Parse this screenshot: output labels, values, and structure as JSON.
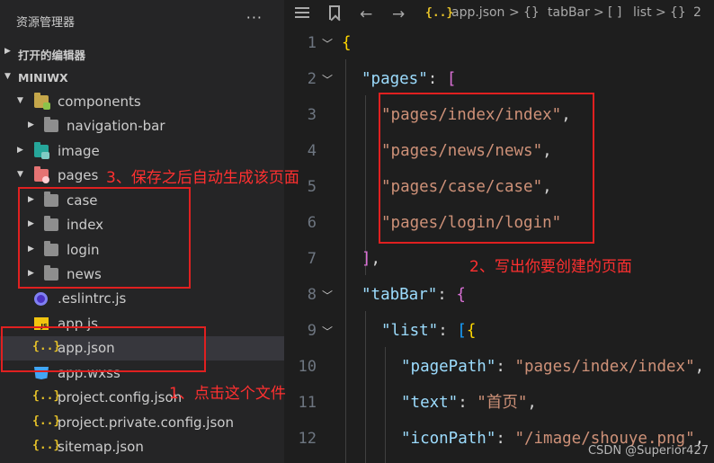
{
  "sidebar": {
    "title": "资源管理器",
    "more": "···",
    "open_editors": "打开的编辑器",
    "project": "MINIWX",
    "tree": [
      {
        "label": "components",
        "icon": "components-folder-icon"
      },
      {
        "label": "navigation-bar",
        "icon": "folder-icon"
      },
      {
        "label": "image",
        "icon": "image-folder-icon"
      },
      {
        "label": "pages",
        "icon": "pages-folder-icon"
      },
      {
        "label": "case",
        "icon": "folder-icon"
      },
      {
        "label": "index",
        "icon": "folder-icon"
      },
      {
        "label": "login",
        "icon": "folder-icon"
      },
      {
        "label": "news",
        "icon": "folder-icon"
      },
      {
        "label": ".eslintrc.js",
        "icon": "eslint-icon"
      },
      {
        "label": "app.js",
        "icon": "js-icon"
      },
      {
        "label": "app.json",
        "icon": "json-icon",
        "selected": true
      },
      {
        "label": "app.wxss",
        "icon": "css-icon"
      },
      {
        "label": "project.config.json",
        "icon": "json-icon"
      },
      {
        "label": "project.private.config.json",
        "icon": "json-icon"
      },
      {
        "label": "sitemap.json",
        "icon": "json-icon"
      }
    ]
  },
  "breadcrumb": {
    "json_glyph": "{..}",
    "file": "app.json",
    "sep": ">",
    "obj_glyph": "{}",
    "tabbar": "tabBar",
    "arr_glyph": "[ ]",
    "list": "list",
    "obj2_glyph": "{}",
    "index": "2"
  },
  "editor": {
    "line_numbers": [
      "1",
      "2",
      "3",
      "4",
      "5",
      "6",
      "7",
      "8",
      "9",
      "10",
      "11",
      "12"
    ],
    "code": {
      "l1_brace": "{",
      "l2_key": "\"pages\"",
      "l2_rest": ": ",
      "l2_bracket": "[",
      "l3": "\"pages/index/index\"",
      "l4": "\"pages/news/news\"",
      "l5": "\"pages/case/case\"",
      "l6": "\"pages/login/login\"",
      "comma": ",",
      "l7_bracket": "]",
      "l8_key": "\"tabBar\"",
      "l8_rest": ": ",
      "l8_brace": "{",
      "l9_key": "\"list\"",
      "l9_rest": ": ",
      "l9_bracket": "[",
      "l9_brace": "{",
      "l10_key": "\"pagePath\"",
      "l10_val": "\"pages/index/index\"",
      "l11_key": "\"text\"",
      "l11_val": "\"首页\"",
      "l12_key": "\"iconPath\"",
      "l12_val": "\"/image/shouye.png\""
    }
  },
  "annotations": {
    "step1": "1、点击这个文件",
    "step2": "2、写出你要创建的页面",
    "step3": "3、保存之后自动生成该页面",
    "color": "#e02020"
  },
  "watermark": "CSDN @Superior427"
}
